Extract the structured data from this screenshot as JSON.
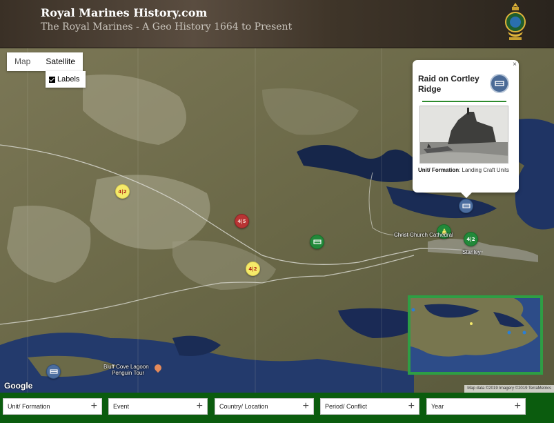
{
  "header": {
    "site_title": "Royal Marines History.com",
    "site_subtitle": "The Royal Marines - A Geo History 1664 to Present"
  },
  "map": {
    "type_buttons": [
      "Map",
      "Satellite"
    ],
    "active_type": "Satellite",
    "labels_checkbox": {
      "label": "Labels",
      "checked": true
    },
    "place_labels": {
      "christ_church": "Christ Church Cathedral",
      "stanley": "Stanley",
      "bluff_cove_1": "Bluff Cove Lagoon",
      "bluff_cove_2": "Penguin Tour"
    },
    "logo": "Google",
    "attribution": "Map data ©2019 Imagery ©2019 TerraMetrics"
  },
  "infowindow": {
    "title": "Raid on Cortley Ridge",
    "close_glyph": "×",
    "meta_label": "Unit/ Formation",
    "meta_value": ": Landing Craft Units",
    "icon": "landing-craft-icon"
  },
  "markers": {
    "unit_label_a": "4|2",
    "unit_label_b": "4|5",
    "unit_label_c": "4|2",
    "unit_label_d": "4|2"
  },
  "filters": [
    {
      "label": "Unit/ Formation"
    },
    {
      "label": "Event"
    },
    {
      "label": "Country/ Location"
    },
    {
      "label": "Period/ Conflict"
    },
    {
      "label": "Year"
    }
  ],
  "filter_add_glyph": "+",
  "colors": {
    "filter_bar": "#0b5c0e",
    "overview_border": "#2e9e44",
    "accent_rule": "#2e8b2e"
  }
}
